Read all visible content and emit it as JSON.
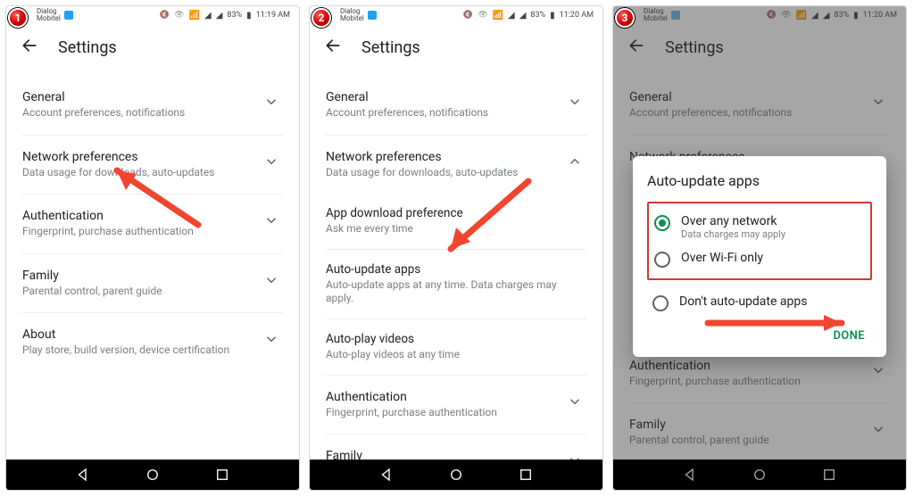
{
  "badges": {
    "one": "1",
    "two": "2",
    "three": "3"
  },
  "status": {
    "carrier": "Dialog\nMobitel",
    "battery": "83%",
    "time1": "11:19 AM",
    "time2": "11:20 AM",
    "time3": "11:20 AM"
  },
  "header": {
    "title": "Settings"
  },
  "panel1": {
    "items": [
      {
        "title": "General",
        "sub": "Account preferences, notifications",
        "chev": "down"
      },
      {
        "title": "Network preferences",
        "sub": "Data usage for downloads, auto-updates",
        "chev": "down"
      },
      {
        "title": "Authentication",
        "sub": "Fingerprint, purchase authentication",
        "chev": "down"
      },
      {
        "title": "Family",
        "sub": "Parental control, parent guide",
        "chev": "down"
      },
      {
        "title": "About",
        "sub": "Play store, build version, device certification",
        "chev": "down"
      }
    ]
  },
  "panel2": {
    "items_top": [
      {
        "title": "General",
        "sub": "Account preferences, notifications",
        "chev": "down"
      },
      {
        "title": "Network preferences",
        "sub": "Data usage for downloads, auto-updates",
        "chev": "up"
      }
    ],
    "subitems": [
      {
        "title": "App download preference",
        "sub": "Ask me every time"
      },
      {
        "title": "Auto-update apps",
        "sub": "Auto-update apps at any time. Data charges may apply."
      },
      {
        "title": "Auto-play videos",
        "sub": "Auto-play videos at any time"
      }
    ],
    "items_bottom": [
      {
        "title": "Authentication",
        "sub": "Fingerprint, purchase authentication",
        "chev": "down"
      },
      {
        "title": "Family",
        "sub": "",
        "chev": "down"
      }
    ]
  },
  "panel3": {
    "items": [
      {
        "title": "General",
        "sub": "Account preferences, notifications",
        "chev": "down"
      },
      {
        "title": "Network preferences",
        "sub": "",
        "chev": ""
      },
      {
        "title": "Authentication",
        "sub": "Fingerprint, purchase authentication",
        "chev": "down"
      },
      {
        "title": "Family",
        "sub": "Parental control, parent guide",
        "chev": "down"
      }
    ],
    "dialog": {
      "title": "Auto-update apps",
      "opt1": {
        "label": "Over any network",
        "sub": "Data charges may apply"
      },
      "opt2": {
        "label": "Over Wi-Fi only"
      },
      "opt3": {
        "label": "Don't auto-update apps"
      },
      "done": "DONE"
    }
  }
}
